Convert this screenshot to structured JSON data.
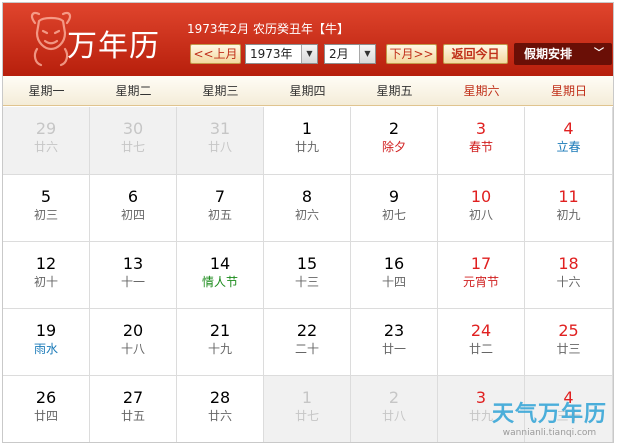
{
  "header": {
    "app_title": "万年历",
    "date_info": "1973年2月 农历癸丑年【牛】",
    "prev_month_label": "<<上月",
    "year_select": "1973年",
    "month_select": "2月",
    "next_month_label": "下月>>",
    "today_label": "返回今日",
    "holiday_select": "假期安排"
  },
  "weekdays": [
    "星期一",
    "星期二",
    "星期三",
    "星期四",
    "星期五",
    "星期六",
    "星期日"
  ],
  "weeks": [
    [
      {
        "day": "29",
        "lunar": "廿六",
        "other": true
      },
      {
        "day": "30",
        "lunar": "廿七",
        "other": true
      },
      {
        "day": "31",
        "lunar": "廿八",
        "other": true
      },
      {
        "day": "1",
        "lunar": "廿九"
      },
      {
        "day": "2",
        "lunar": "除夕",
        "lunar_color": "red"
      },
      {
        "day": "3",
        "lunar": "春节",
        "lunar_color": "red"
      },
      {
        "day": "4",
        "lunar": "立春",
        "lunar_color": "blue"
      }
    ],
    [
      {
        "day": "5",
        "lunar": "初三"
      },
      {
        "day": "6",
        "lunar": "初四"
      },
      {
        "day": "7",
        "lunar": "初五"
      },
      {
        "day": "8",
        "lunar": "初六"
      },
      {
        "day": "9",
        "lunar": "初七"
      },
      {
        "day": "10",
        "lunar": "初八"
      },
      {
        "day": "11",
        "lunar": "初九"
      }
    ],
    [
      {
        "day": "12",
        "lunar": "初十"
      },
      {
        "day": "13",
        "lunar": "十一"
      },
      {
        "day": "14",
        "lunar": "情人节",
        "lunar_color": "green"
      },
      {
        "day": "15",
        "lunar": "十三"
      },
      {
        "day": "16",
        "lunar": "十四"
      },
      {
        "day": "17",
        "lunar": "元宵节",
        "lunar_color": "red"
      },
      {
        "day": "18",
        "lunar": "十六"
      }
    ],
    [
      {
        "day": "19",
        "lunar": "雨水",
        "lunar_color": "blue"
      },
      {
        "day": "20",
        "lunar": "十八"
      },
      {
        "day": "21",
        "lunar": "十九"
      },
      {
        "day": "22",
        "lunar": "二十"
      },
      {
        "day": "23",
        "lunar": "廿一"
      },
      {
        "day": "24",
        "lunar": "廿二"
      },
      {
        "day": "25",
        "lunar": "廿三"
      }
    ],
    [
      {
        "day": "26",
        "lunar": "廿四"
      },
      {
        "day": "27",
        "lunar": "廿五"
      },
      {
        "day": "28",
        "lunar": "廿六"
      },
      {
        "day": "1",
        "lunar": "廿七",
        "other": true
      },
      {
        "day": "2",
        "lunar": "廿八",
        "other": true
      },
      {
        "day": "3",
        "lunar": "廿九",
        "other": true
      },
      {
        "day": "4",
        "lunar": "三十",
        "other": true
      }
    ]
  ],
  "watermark": {
    "title": "天气万年历",
    "url": "wannianli.tianqi.com"
  },
  "colors": {
    "header_red": "#c8290f",
    "weekend_red": "#e02020",
    "festival_green": "#1a8a1a",
    "solar_term_blue": "#1a7ab8"
  },
  "icons": {
    "logo": "ox-icon",
    "prev": "double-chevron-left",
    "next": "double-chevron-right",
    "dropdown": "chevron-down-icon"
  }
}
